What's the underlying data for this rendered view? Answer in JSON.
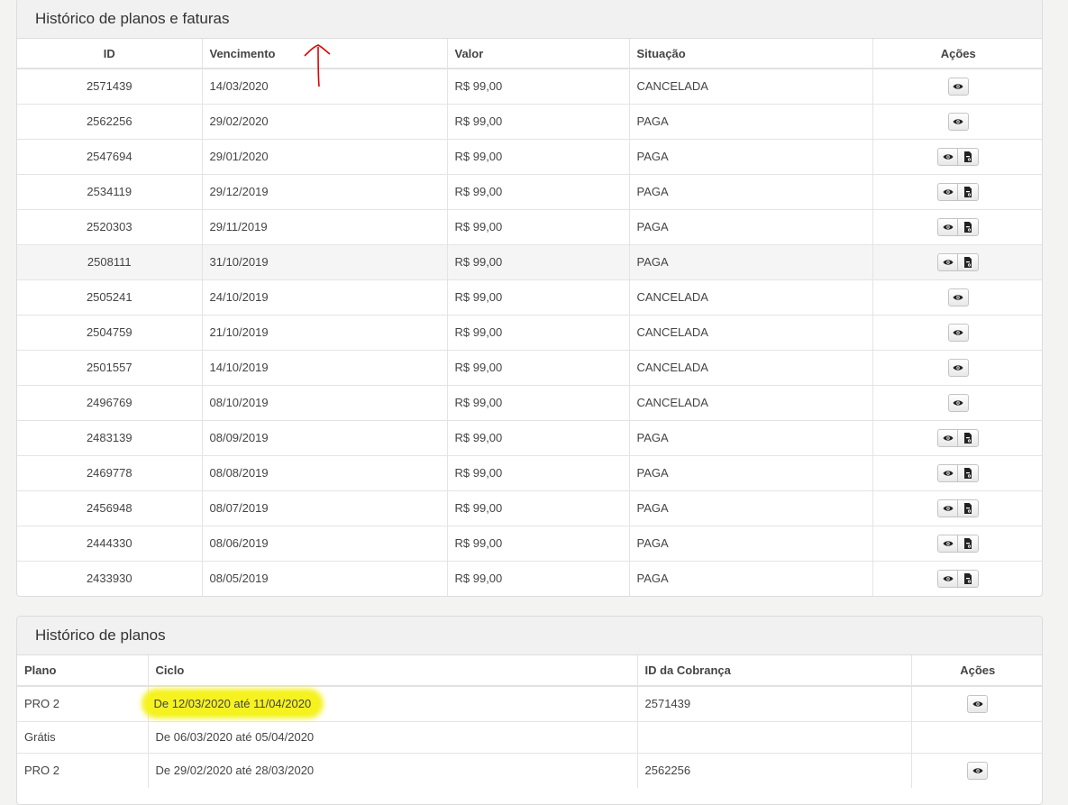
{
  "invoices_panel": {
    "title": "Histórico de planos e faturas",
    "columns": [
      "ID",
      "Vencimento",
      "Valor",
      "Situação",
      "Ações"
    ],
    "rows": [
      {
        "id": "2571439",
        "due": "14/03/2020",
        "value": "R$ 99,00",
        "status": "CANCELADA",
        "actions": [
          "view"
        ]
      },
      {
        "id": "2562256",
        "due": "29/02/2020",
        "value": "R$ 99,00",
        "status": "PAGA",
        "actions": [
          "view"
        ]
      },
      {
        "id": "2547694",
        "due": "29/01/2020",
        "value": "R$ 99,00",
        "status": "PAGA",
        "actions": [
          "view",
          "receipt"
        ]
      },
      {
        "id": "2534119",
        "due": "29/12/2019",
        "value": "R$ 99,00",
        "status": "PAGA",
        "actions": [
          "view",
          "receipt"
        ]
      },
      {
        "id": "2520303",
        "due": "29/11/2019",
        "value": "R$ 99,00",
        "status": "PAGA",
        "actions": [
          "view",
          "receipt"
        ]
      },
      {
        "id": "2508111",
        "due": "31/10/2019",
        "value": "R$ 99,00",
        "status": "PAGA",
        "actions": [
          "view",
          "receipt"
        ],
        "hover": true
      },
      {
        "id": "2505241",
        "due": "24/10/2019",
        "value": "R$ 99,00",
        "status": "CANCELADA",
        "actions": [
          "view"
        ]
      },
      {
        "id": "2504759",
        "due": "21/10/2019",
        "value": "R$ 99,00",
        "status": "CANCELADA",
        "actions": [
          "view"
        ]
      },
      {
        "id": "2501557",
        "due": "14/10/2019",
        "value": "R$ 99,00",
        "status": "CANCELADA",
        "actions": [
          "view"
        ]
      },
      {
        "id": "2496769",
        "due": "08/10/2019",
        "value": "R$ 99,00",
        "status": "CANCELADA",
        "actions": [
          "view"
        ]
      },
      {
        "id": "2483139",
        "due": "08/09/2019",
        "value": "R$ 99,00",
        "status": "PAGA",
        "actions": [
          "view",
          "receipt"
        ]
      },
      {
        "id": "2469778",
        "due": "08/08/2019",
        "value": "R$ 99,00",
        "status": "PAGA",
        "actions": [
          "view",
          "receipt"
        ]
      },
      {
        "id": "2456948",
        "due": "08/07/2019",
        "value": "R$ 99,00",
        "status": "PAGA",
        "actions": [
          "view",
          "receipt"
        ]
      },
      {
        "id": "2444330",
        "due": "08/06/2019",
        "value": "R$ 99,00",
        "status": "PAGA",
        "actions": [
          "view",
          "receipt"
        ]
      },
      {
        "id": "2433930",
        "due": "08/05/2019",
        "value": "R$ 99,00",
        "status": "PAGA",
        "actions": [
          "view",
          "receipt"
        ]
      }
    ]
  },
  "plans_panel": {
    "title": "Histórico de planos",
    "columns": [
      "Plano",
      "Ciclo",
      "ID da Cobrança",
      "Ações"
    ],
    "rows": [
      {
        "plan": "PRO 2",
        "cycle": "De 12/03/2020 até 11/04/2020",
        "charge_id": "2571439",
        "actions": [
          "view"
        ],
        "highlighted": true
      },
      {
        "plan": "Grátis",
        "cycle": "De 06/03/2020 até 05/04/2020",
        "charge_id": "",
        "actions": []
      },
      {
        "plan": "PRO 2",
        "cycle": "De 29/02/2020 até 28/03/2020",
        "charge_id": "2562256",
        "actions": [
          "view"
        ]
      }
    ]
  },
  "icons": {
    "view": "eye-icon",
    "receipt": "receipt-icon"
  },
  "colors": {
    "annotation_arrow": "#e00000",
    "highlight": "#f5f220"
  }
}
